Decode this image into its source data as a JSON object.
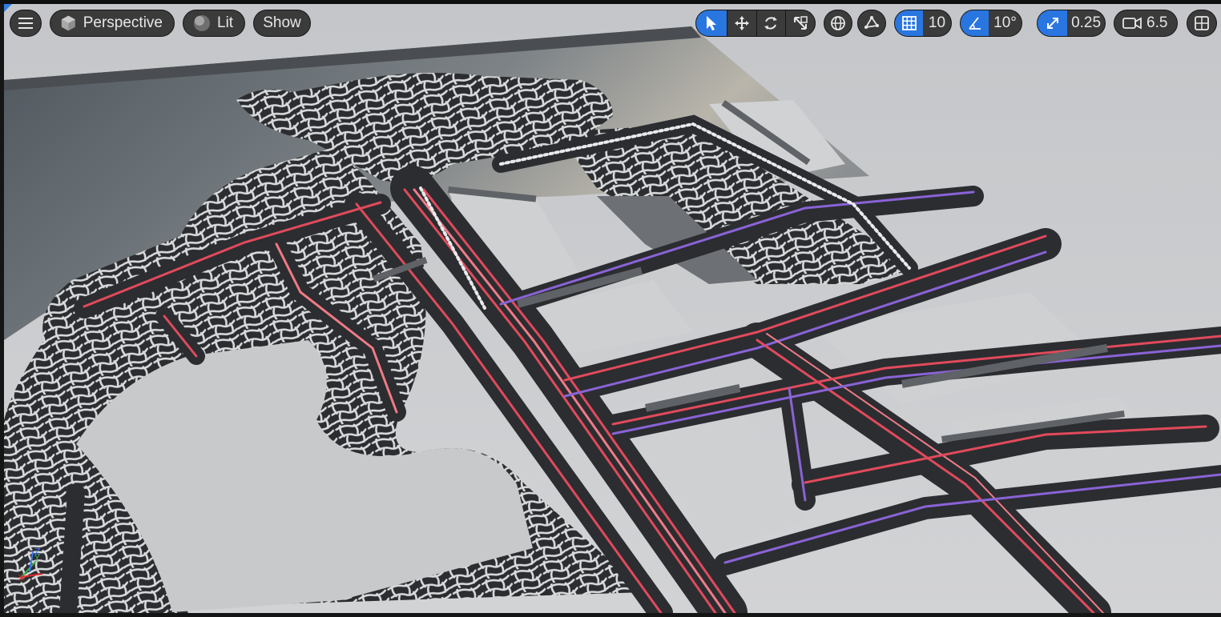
{
  "toolbar": {
    "menu_icon": "hamburger-menu-icon",
    "view_mode": {
      "icon": "cube-icon",
      "label": "Perspective"
    },
    "lighting": {
      "icon": "lit-sphere-icon",
      "label": "Lit"
    },
    "show_label": "Show",
    "transform_tools": [
      {
        "name": "select-tool",
        "icon": "cursor-arrow-icon",
        "active": true
      },
      {
        "name": "move-tool",
        "icon": "move-arrows-icon",
        "active": false
      },
      {
        "name": "rotate-tool",
        "icon": "rotate-icon",
        "active": false
      },
      {
        "name": "scale-tool",
        "icon": "scale-icon",
        "active": false
      }
    ],
    "world_local_icon": "globe-icon",
    "surface_snap_icon": "surface-snap-icon",
    "grid_snap": {
      "icon": "grid-icon",
      "value": "10",
      "active": true
    },
    "rotation_snap": {
      "icon": "angle-icon",
      "value": "10°",
      "active": true
    },
    "scale_snap": {
      "icon": "scale-arrow-icon",
      "value": "0.25",
      "active": true
    },
    "camera_speed": {
      "icon": "camera-icon",
      "value": "6.5"
    },
    "layout_icon": "viewport-layout-icon"
  },
  "colors": {
    "accent": "#2a76e0",
    "toolbar_bg": "#303032",
    "road_surface": "#2b2d30",
    "road_lane_red": "#e14a5c",
    "road_lane_purple": "#8a63d6",
    "ground": "#b6b8bb",
    "water": "#6b7278"
  },
  "gizmo": {
    "icon": "axis-gizmo-icon",
    "x_color": "#e02a2a",
    "y_color": "#3fb34a",
    "z_color": "#3b7bff"
  }
}
